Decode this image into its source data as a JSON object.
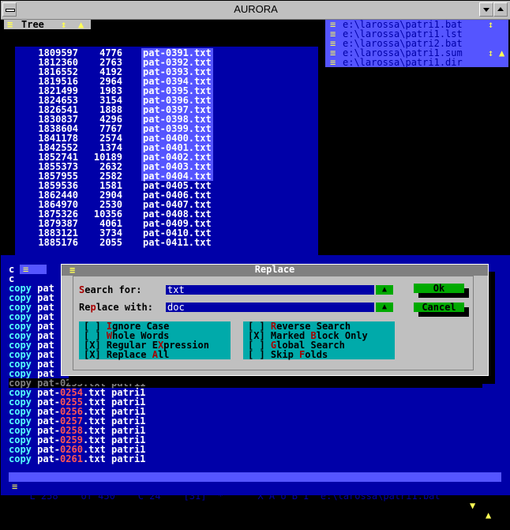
{
  "window": {
    "title": "AURORA"
  },
  "tree_pane": {
    "tab_label": "Tree"
  },
  "tree_rows": [
    {
      "a": "1809597",
      "b": "4776",
      "name": "pat-0391.txt",
      "selected": true
    },
    {
      "a": "1812360",
      "b": "2763",
      "name": "pat-0392.txt",
      "selected": true
    },
    {
      "a": "1816552",
      "b": "4192",
      "name": "pat-0393.txt",
      "selected": true
    },
    {
      "a": "1819516",
      "b": "2964",
      "name": "pat-0394.txt",
      "selected": true
    },
    {
      "a": "1821499",
      "b": "1983",
      "name": "pat-0395.txt",
      "selected": true
    },
    {
      "a": "1824653",
      "b": "3154",
      "name": "pat-0396.txt",
      "selected": true
    },
    {
      "a": "1826541",
      "b": "1888",
      "name": "pat-0397.txt",
      "selected": true
    },
    {
      "a": "1830837",
      "b": "4296",
      "name": "pat-0398.txt",
      "selected": true
    },
    {
      "a": "1838604",
      "b": "7767",
      "name": "pat-0399.txt",
      "selected": true
    },
    {
      "a": "1841178",
      "b": "2574",
      "name": "pat-0400.txt",
      "selected": true
    },
    {
      "a": "1842552",
      "b": "1374",
      "name": "pat-0401.txt",
      "selected": true
    },
    {
      "a": "1852741",
      "b": "10189",
      "name": "pat-0402.txt",
      "selected": true
    },
    {
      "a": "1855373",
      "b": "2632",
      "name": "pat-0403.txt",
      "selected": true
    },
    {
      "a": "1857955",
      "b": "2582",
      "name": "pat-0404.txt",
      "selected": true
    },
    {
      "a": "1859536",
      "b": "1581",
      "name": "pat-0405.txt",
      "selected": false
    },
    {
      "a": "1862440",
      "b": "2904",
      "name": "pat-0406.txt",
      "selected": false
    },
    {
      "a": "1864970",
      "b": "2530",
      "name": "pat-0407.txt",
      "selected": false
    },
    {
      "a": "1875326",
      "b": "10356",
      "name": "pat-0408.txt",
      "selected": false
    },
    {
      "a": "1879387",
      "b": "4061",
      "name": "pat-0409.txt",
      "selected": false
    },
    {
      "a": "1883121",
      "b": "3734",
      "name": "pat-0410.txt",
      "selected": false
    },
    {
      "a": "1885176",
      "b": "2055",
      "name": "pat-0411.txt",
      "selected": false
    }
  ],
  "file_list": [
    "e:\\larossa\\patri1.bat",
    "e:\\larossa\\patri1.lst",
    "e:\\larossa\\patri2.bat",
    "e:\\larossa\\patri1.sum",
    "e:\\larossa\\patri1.dir"
  ],
  "editor": {
    "top_lines": [
      "c",
      "c"
    ],
    "partial_prefix": [
      "copy pat",
      "copy pat",
      "copy pat",
      "copy pat",
      "copy pat",
      "copy pat",
      "copy pat",
      "copy pat",
      "copy pat",
      "copy pat"
    ],
    "first_partial": "copy pat",
    "lines": [
      {
        "cmd": "copy",
        "pre": "pat-",
        "num": "0253",
        "post": ".txt patri1",
        "dim": true
      },
      {
        "cmd": "copy",
        "pre": "pat-",
        "num": "0254",
        "post": ".txt patri1"
      },
      {
        "cmd": "copy",
        "pre": "pat-",
        "num": "0255",
        "post": ".txt patri1"
      },
      {
        "cmd": "copy",
        "pre": "pat-",
        "num": "0256",
        "post": ".txt patri1"
      },
      {
        "cmd": "copy",
        "pre": "pat-",
        "num": "0257",
        "post": ".txt patri1"
      },
      {
        "cmd": "copy",
        "pre": "pat-",
        "num": "0258",
        "post": ".txt patri1"
      },
      {
        "cmd": "copy",
        "pre": "pat-",
        "num": "0259",
        "post": ".txt patri1"
      },
      {
        "cmd": "copy",
        "pre": "pat-",
        "num": "0260",
        "post": ".txt patri1"
      },
      {
        "cmd": "copy",
        "pre": "pat-",
        "num": "0261",
        "post": ".txt patri1"
      }
    ]
  },
  "status": {
    "text": "  L 258    of 450    C 24    [31]  *      X A U B I  e:\\larossa\\patri1.bat"
  },
  "dialog": {
    "title": "Replace",
    "search_label_hot": "S",
    "search_label_rest": "earch for:",
    "search_value": "txt",
    "replace_label_pre": "Re",
    "replace_label_hot": "p",
    "replace_label_rest": "lace with:",
    "replace_value": "doc",
    "ok_label": "Ok",
    "cancel_label": "Cancel",
    "left_options": [
      {
        "box": "[ ]",
        "hot": "I",
        "rest": "gnore Case"
      },
      {
        "box": "[ ]",
        "hot": "W",
        "rest": "hole Words"
      },
      {
        "box": "[X]",
        "pre": "Regular E",
        "hot": "X",
        "rest": "pression"
      },
      {
        "box": "[X]",
        "pre": "Replace ",
        "hot": "A",
        "rest": "ll"
      }
    ],
    "right_options": [
      {
        "box": "[ ]",
        "hot": "R",
        "rest": "everse Search"
      },
      {
        "box": "[X]",
        "pre": "Marked ",
        "hot": "B",
        "rest": "lock Only"
      },
      {
        "box": "[ ]",
        "hot": "G",
        "rest": "lobal Search"
      },
      {
        "box": "[ ]",
        "pre": "Skip ",
        "hot": "F",
        "rest": "olds"
      }
    ]
  },
  "colors": {
    "editor_bg": "#0000a8",
    "accent": "#5555ff",
    "keyword": "#55ffff",
    "number": "#ff5555",
    "dialog_bg": "#c0c0c0",
    "button": "#00aa00"
  }
}
